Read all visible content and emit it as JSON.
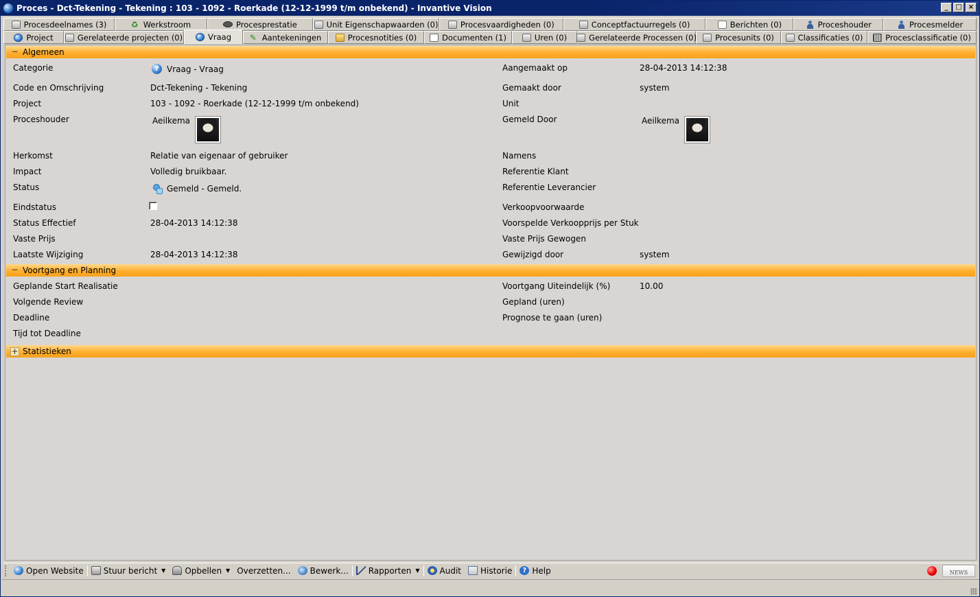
{
  "window": {
    "title": "Proces - Dct-Tekening - Tekening : 103 - 1092 - Roerkade (12-12-1999 t/m onbekend) - Invantive Vision",
    "controls": [
      "minimize",
      "maximize",
      "close"
    ]
  },
  "tabs_row1": [
    {
      "label": "Procesdeelnames (3)",
      "icon": "gear-window-icon"
    },
    {
      "label": "Werkstroom",
      "icon": "recycle-icon"
    },
    {
      "label": "Procesprestatie",
      "icon": "binoculars-icon"
    },
    {
      "label": "Unit Eigenschapwaarden (0)",
      "icon": "window-icon"
    },
    {
      "label": "Procesvaardigheden (0)",
      "icon": "window-icon"
    },
    {
      "label": "Conceptfactuurregels (0)",
      "icon": "window-icon"
    },
    {
      "label": "Berichten (0)",
      "icon": "envelope-icon"
    },
    {
      "label": "Proceshouder",
      "icon": "person-icon"
    },
    {
      "label": "Procesmelder",
      "icon": "person-icon"
    }
  ],
  "tabs_row2": [
    {
      "label": "Project",
      "icon": "globe-icon"
    },
    {
      "label": "Gerelateerde projecten (0)",
      "icon": "window-icon"
    },
    {
      "label": "Vraag",
      "icon": "globe-icon",
      "active": true
    },
    {
      "label": "Aantekeningen",
      "icon": "pin-icon"
    },
    {
      "label": "Procesnotities (0)",
      "icon": "folder-icon"
    },
    {
      "label": "Documenten (1)",
      "icon": "document-icon"
    },
    {
      "label": "Uren (0)",
      "icon": "window-icon"
    },
    {
      "label": "Gerelateerde Processen (0)",
      "icon": "window-icon"
    },
    {
      "label": "Procesunits (0)",
      "icon": "window-icon"
    },
    {
      "label": "Classificaties (0)",
      "icon": "window-icon"
    },
    {
      "label": "Procesclassificatie (0)",
      "icon": "barcode-icon"
    }
  ],
  "sections": {
    "algemeen": {
      "title": "Algemeen",
      "toggle": "−"
    },
    "voortgang": {
      "title": "Voortgang en Planning",
      "toggle": "−"
    },
    "statistieken": {
      "title": "Statistieken",
      "toggle": "+"
    }
  },
  "algemeen_left": {
    "categorie": {
      "label": "Categorie",
      "value": "Vraag - Vraag"
    },
    "code": {
      "label": "Code en Omschrijving",
      "value": "Dct-Tekening - Tekening"
    },
    "project": {
      "label": "Project",
      "value": "103 - 1092 - Roerkade (12-12-1999 t/m onbekend)"
    },
    "proceshouder": {
      "label": "Proceshouder",
      "value": "Aeilkema"
    },
    "herkomst": {
      "label": "Herkomst",
      "value": "Relatie van eigenaar of gebruiker"
    },
    "impact": {
      "label": "Impact",
      "value": "Volledig bruikbaar."
    },
    "status": {
      "label": "Status",
      "value": "Gemeld - Gemeld."
    },
    "eindstatus": {
      "label": "Eindstatus",
      "checked": false
    },
    "status_effectief": {
      "label": "Status Effectief",
      "value": "28-04-2013 14:12:38"
    },
    "vaste_prijs": {
      "label": "Vaste Prijs",
      "value": ""
    },
    "laatste_wijziging": {
      "label": "Laatste Wijziging",
      "value": "28-04-2013 14:12:38"
    }
  },
  "algemeen_right": {
    "aangemaakt_op": {
      "label": "Aangemaakt op",
      "value": "28-04-2013 14:12:38"
    },
    "gemaakt_door": {
      "label": "Gemaakt door",
      "value": "system"
    },
    "unit": {
      "label": "Unit",
      "value": ""
    },
    "gemeld_door": {
      "label": "Gemeld Door",
      "value": "Aeilkema"
    },
    "namens": {
      "label": "Namens",
      "value": ""
    },
    "ref_klant": {
      "label": "Referentie Klant",
      "value": ""
    },
    "ref_leverancier": {
      "label": "Referentie Leverancier",
      "value": ""
    },
    "verkoopvoorwaarde": {
      "label": "Verkoopvoorwaarde",
      "value": ""
    },
    "voorspelde_prijs": {
      "label": "Voorspelde Verkoopprijs per Stuk",
      "value": ""
    },
    "vaste_prijs_gewogen": {
      "label": "Vaste Prijs Gewogen",
      "value": ""
    },
    "gewijzigd_door": {
      "label": "Gewijzigd door",
      "value": "system"
    }
  },
  "voortgang_left": {
    "geplande_start": {
      "label": "Geplande Start Realisatie",
      "value": ""
    },
    "volgende_review": {
      "label": "Volgende Review",
      "value": ""
    },
    "deadline": {
      "label": "Deadline",
      "value": ""
    },
    "tijd_tot_deadline": {
      "label": "Tijd tot Deadline",
      "value": ""
    }
  },
  "voortgang_right": {
    "voortgang": {
      "label": "Voortgang Uiteindelijk (%)",
      "value": "10.00"
    },
    "gepland": {
      "label": "Gepland (uren)",
      "value": ""
    },
    "prognose": {
      "label": "Prognose te gaan (uren)",
      "value": ""
    }
  },
  "statusbar": {
    "open_website": "Open Website",
    "stuur_bericht": "Stuur bericht",
    "opbellen": "Opbellen",
    "overzetten": "Overzetten...",
    "bewerk": "Bewerk...",
    "rapporten": "Rapporten",
    "audit": "Audit",
    "historie": "Historie",
    "help": "Help",
    "news": "NEWS"
  }
}
